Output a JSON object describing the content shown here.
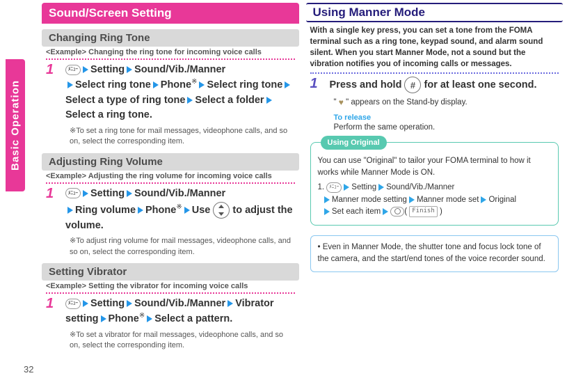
{
  "sidebar": {
    "label": "Basic Operation"
  },
  "page_number": "32",
  "left": {
    "main_title": "Sound/Screen Setting",
    "sections": [
      {
        "heading": "Changing Ring Tone",
        "example": "<Example> Changing the ring tone for incoming voice calls",
        "step_prefix": "1",
        "path_items": [
          "Setting",
          "Sound/Vib./Manner",
          "Select ring tone",
          "Phone※",
          "Select ring tone",
          "Select a type of ring tone",
          "Select a folder",
          "Select a ring tone."
        ],
        "note": "※To set a ring tone for mail messages, videophone calls, and so on, select the corresponding item."
      },
      {
        "heading": "Adjusting Ring Volume",
        "example": "<Example> Adjusting the ring volume for incoming voice calls",
        "step_prefix": "1",
        "path_items": [
          "Setting",
          "Sound/Vib./Manner",
          "Ring volume",
          "Phone※",
          "Use 🔘 to adjust the volume."
        ],
        "note": "※To adjust ring volume for mail messages, videophone calls, and so on, select the corresponding item."
      },
      {
        "heading": "Setting Vibrator",
        "example": "<Example> Setting the vibrator for incoming voice calls",
        "step_prefix": "1",
        "path_items": [
          "Setting",
          "Sound/Vib./Manner",
          "Vibrator setting",
          "Phone※",
          "Select a pattern."
        ],
        "note": "※To set a vibrator for mail messages, videophone calls, and so on, select the corresponding item."
      }
    ]
  },
  "right": {
    "main_title": "Using Manner Mode",
    "intro": "With a single key press, you can set a tone from the FOMA terminal such as a ring tone, keypad sound, and alarm sound silent. When you start Manner Mode, not a sound but the vibration notifies you of incoming calls or messages.",
    "step_prefix": "1",
    "step_text_pre": "Press and hold ",
    "step_text_post": " for at least one second.",
    "key_label": "#",
    "sub_text_pre": "\" ",
    "sub_text_post": " \" appears on the Stand-by display.",
    "release_title": "To release",
    "release_text": "Perform the same operation.",
    "info_tag": "Using Original",
    "info_intro": "You can use \"Original\" to tailor your FOMA terminal to how it works while Manner Mode is ON.",
    "info_path_label": "1.",
    "info_path_items": [
      "Setting",
      "Sound/Vib./Manner",
      "Manner mode setting",
      "Manner mode set",
      "Original",
      "Set each item"
    ],
    "info_finish": "Finish",
    "notice": "• Even in Manner Mode, the shutter tone and focus lock tone of the camera, and the start/end tones of the voice recorder sound."
  }
}
